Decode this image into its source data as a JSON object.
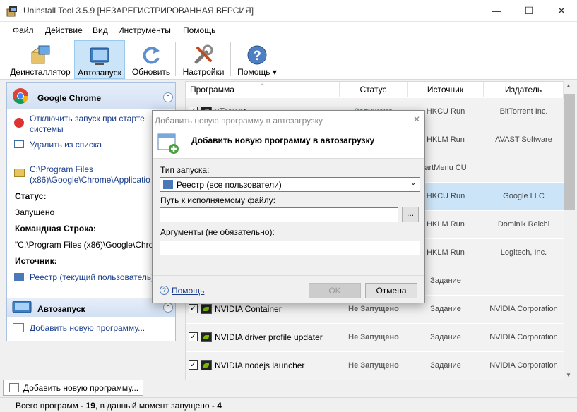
{
  "window": {
    "title": "Uninstall Tool 3.5.9 [НЕЗАРЕГИСТРИРОВАННАЯ ВЕРСИЯ]"
  },
  "menu": [
    "Файл",
    "Действие",
    "Вид",
    "Инструменты",
    "Помощь"
  ],
  "toolbar": [
    {
      "label": "Деинсталлятор",
      "icon": "uninstaller-icon"
    },
    {
      "label": "Автозапуск",
      "icon": "autorun-icon",
      "active": true
    },
    {
      "label": "Обновить",
      "icon": "refresh-icon"
    },
    {
      "label": "Настройки",
      "icon": "tools-icon"
    },
    {
      "label": "Помощь ▾",
      "icon": "help-icon"
    }
  ],
  "left_panel": {
    "app_name": "Google Chrome",
    "actions": [
      "Отключить запуск при старте",
      "системы",
      "Удалить из списка"
    ],
    "path_lines": [
      "C:\\Program Files",
      "(x86)\\Google\\Chrome\\Applicatio"
    ],
    "status_label": "Статус:",
    "status_value": "Запущено",
    "cmd_label": "Командная Строка:",
    "cmd_value": "\"C:\\Program Files (x86)\\Google\\Chro",
    "source_label": "Источник:",
    "source_value": "Реестр (текущий пользователь)",
    "section2_title": "Автозапуск",
    "add_program": "Добавить новую программу..."
  },
  "grid": {
    "columns": [
      "Программа",
      "Статус",
      "Источник",
      "Издатель"
    ],
    "rows": [
      {
        "name": "uTorrent",
        "status": "Запущено",
        "source": "HKCU Run",
        "publisher": "BitTorrent Inc."
      },
      {
        "name": "",
        "status": "",
        "source": "HKLM Run",
        "publisher": "AVAST Software"
      },
      {
        "name": "",
        "status": "",
        "source": "artMenu CU",
        "publisher": ""
      },
      {
        "name": "",
        "status": "",
        "source": "HKCU Run",
        "publisher": "Google LLC"
      },
      {
        "name": "",
        "status": "",
        "source": "HKLM Run",
        "publisher": "Dominik Reichl"
      },
      {
        "name": "",
        "status": "",
        "source": "HKLM Run",
        "publisher": "Logitech, Inc."
      },
      {
        "name": "",
        "status": "",
        "source": "Задание",
        "publisher": ""
      },
      {
        "name": "NVIDIA Container",
        "status": "Не Запущено",
        "source": "Задание",
        "publisher": "NVIDIA Corporation"
      },
      {
        "name": "NVIDIA driver profile updater",
        "status": "Не Запущено",
        "source": "Задание",
        "publisher": "NVIDIA Corporation"
      },
      {
        "name": "NVIDIA nodejs launcher",
        "status": "Не Запущено",
        "source": "Задание",
        "publisher": "NVIDIA Corporation"
      }
    ]
  },
  "bottom": {
    "add_button": "Добавить новую программу..."
  },
  "status_bar": {
    "prefix": "Всего программ - ",
    "total": "19",
    "middle": ", в данный момент запущено - ",
    "running": "4"
  },
  "dialog": {
    "title": "Добавить новую программу в автозагрузку",
    "header": "Добавить новую программу в автозагрузку",
    "launch_type_label": "Тип запуска:",
    "launch_type_value": "Реестр (все пользователи)",
    "path_label": "Путь к исполняемому файлу:",
    "path_value": "",
    "browse": "...",
    "args_label": "Аргументы (не обязательно):",
    "args_value": "",
    "help": "Помощь",
    "ok": "OK",
    "cancel": "Отмена"
  },
  "colors": {
    "accent": "#cce4f7",
    "running": "#2e9e2e",
    "not_running": "#666666"
  }
}
